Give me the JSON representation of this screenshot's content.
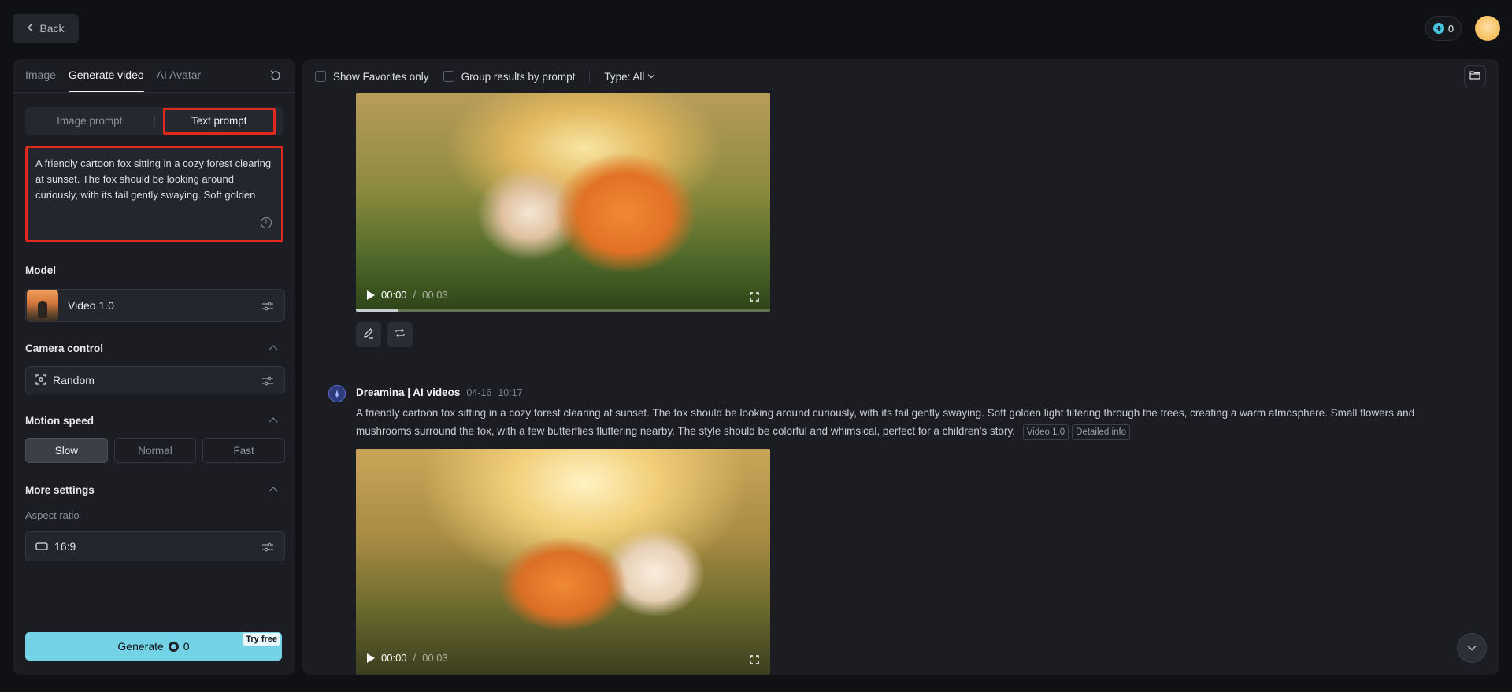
{
  "header": {
    "back_label": "Back",
    "credits": "0"
  },
  "left_panel": {
    "tabs": [
      {
        "label": "Image"
      },
      {
        "label": "Generate video"
      },
      {
        "label": "AI Avatar"
      }
    ],
    "prompt_mode": {
      "image_prompt": "Image prompt",
      "text_prompt": "Text prompt",
      "selected": "Text prompt"
    },
    "prompt_text": "A friendly cartoon fox sitting in a cozy forest clearing at sunset. The fox should be looking around curiously, with its tail gently swaying. Soft golden light filtering through the trees, creating a warm atmosphere. Small flowers and mushrooms surround the fox, with a few butterflies fluttering nearby. The style should be colorful and whimsical, perfect for a children's story.",
    "model": {
      "section_label": "Model",
      "value": "Video 1.0"
    },
    "camera_control": {
      "section_label": "Camera control",
      "value": "Random"
    },
    "motion_speed": {
      "section_label": "Motion speed",
      "options": [
        "Slow",
        "Normal",
        "Fast"
      ],
      "selected": "Slow"
    },
    "more_settings": {
      "section_label": "More settings",
      "aspect_ratio_label": "Aspect ratio",
      "aspect_ratio_value": "16:9"
    },
    "generate": {
      "label": "Generate",
      "cost": "0",
      "badge": "Try free"
    }
  },
  "results": {
    "filters": {
      "favorites_label": "Show Favorites only",
      "group_label": "Group results by prompt",
      "type_label": "Type: All"
    },
    "video1": {
      "time_current": "00:00",
      "time_sep": " / ",
      "time_total": "00:03",
      "progress_fraction": 0.1
    },
    "entry": {
      "author": "Dreamina | AI videos",
      "date": "04-16",
      "time": "10:17",
      "description": "A friendly cartoon fox sitting in a cozy forest clearing at sunset. The fox should be looking around curiously, with its tail gently swaying. Soft golden light filtering through the trees, creating a warm atmosphere. Small flowers and mushrooms surround the fox, with a few butterflies fluttering nearby. The style should be colorful and whimsical, perfect for a children's story.",
      "tag_model": "Video 1.0",
      "tag_info": "Detailed info"
    },
    "video2": {
      "time_current": "00:00",
      "time_sep": " / ",
      "time_total": "00:03"
    }
  },
  "colors": {
    "accent": "#74d2e6",
    "highlight": "#e0291a",
    "background": "#101114",
    "panel": "#1b1d22"
  }
}
